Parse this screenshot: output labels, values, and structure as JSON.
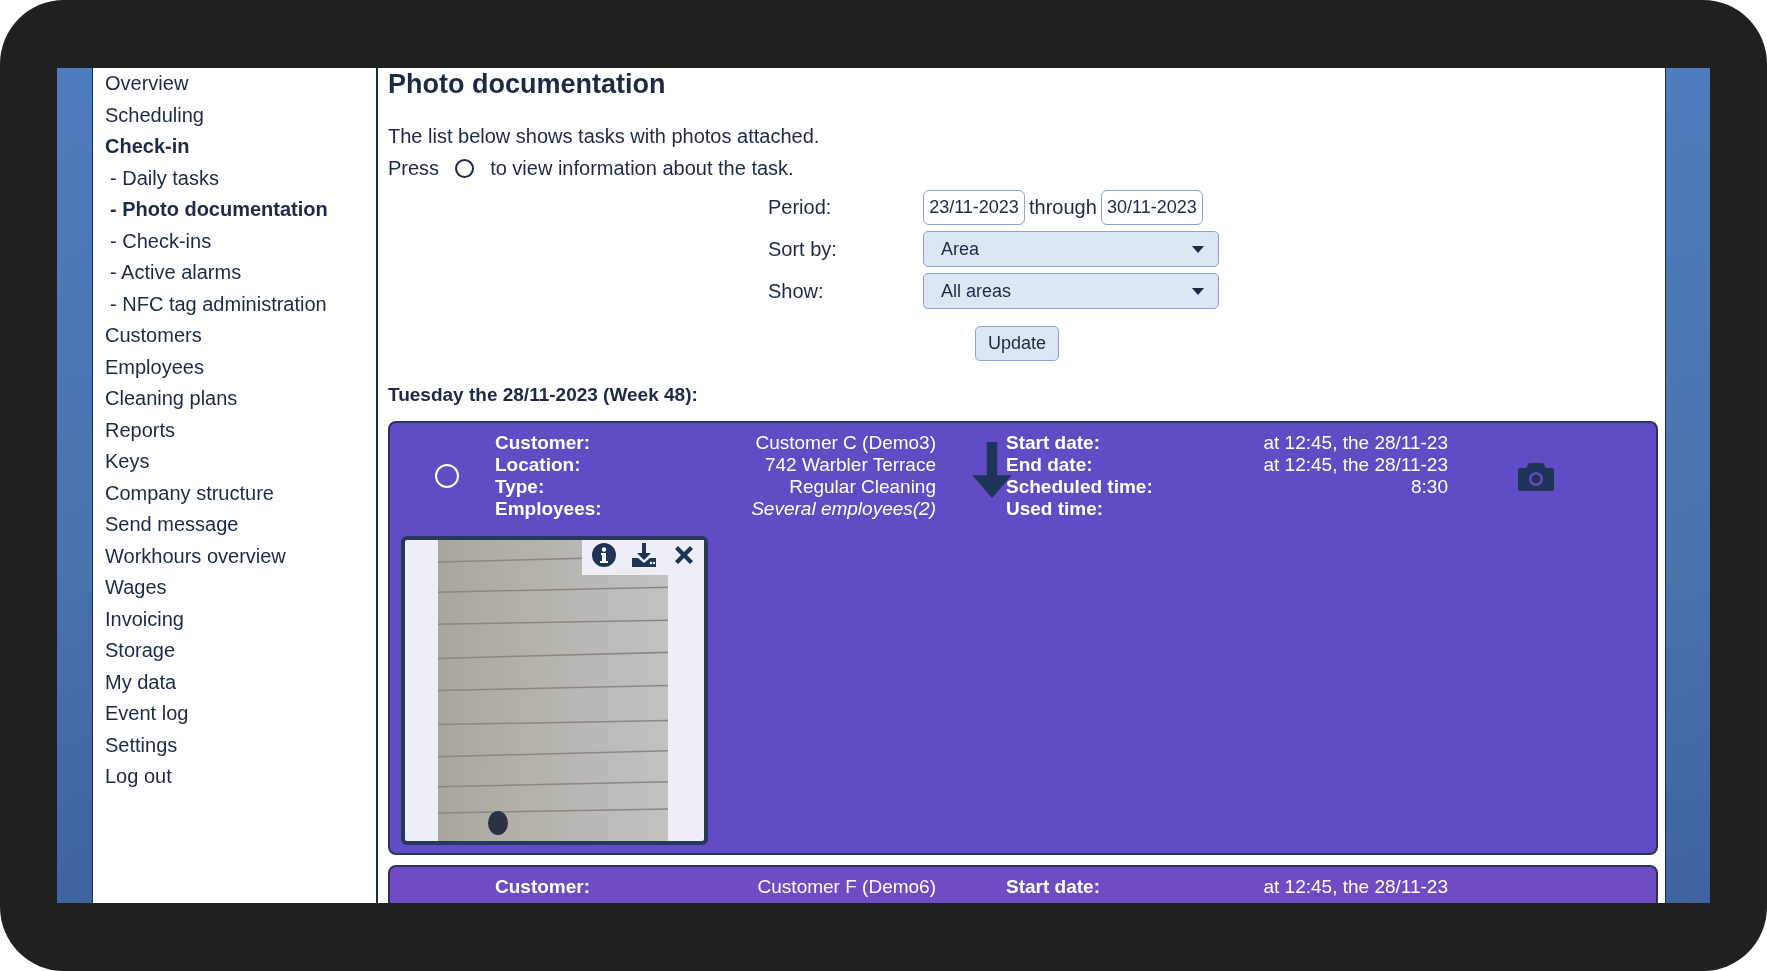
{
  "sidebar": {
    "items": [
      {
        "label": "Overview",
        "selected": false
      },
      {
        "label": "Scheduling",
        "selected": false
      },
      {
        "label": "Check-in",
        "selected": true,
        "children": [
          {
            "label": "- Daily tasks",
            "selected": false
          },
          {
            "label": "- Photo documentation",
            "selected": true
          },
          {
            "label": "- Check-ins",
            "selected": false
          },
          {
            "label": "- Active alarms",
            "selected": false
          },
          {
            "label": "- NFC tag administration",
            "selected": false
          }
        ]
      },
      {
        "label": "Customers",
        "selected": false
      },
      {
        "label": "Employees",
        "selected": false
      },
      {
        "label": "Cleaning plans",
        "selected": false
      },
      {
        "label": "Reports",
        "selected": false
      },
      {
        "label": "Keys",
        "selected": false
      },
      {
        "label": "Company structure",
        "selected": false
      },
      {
        "label": "Send message",
        "selected": false
      },
      {
        "label": "Workhours overview",
        "selected": false
      },
      {
        "label": "Wages",
        "selected": false
      },
      {
        "label": "Invoicing",
        "selected": false
      },
      {
        "label": "Storage",
        "selected": false
      },
      {
        "label": "My data",
        "selected": false
      },
      {
        "label": "Event log",
        "selected": false
      },
      {
        "label": "Settings",
        "selected": false
      },
      {
        "label": "Log out",
        "selected": false
      }
    ]
  },
  "page": {
    "title": "Photo documentation",
    "intro": "The list below shows tasks with photos attached.",
    "hint_before": "Press",
    "hint_after": "to view information about the task."
  },
  "filters": {
    "period_label": "Period:",
    "period_from": "23/11-2023",
    "period_joiner": "through",
    "period_to": "30/11-2023",
    "sort_label": "Sort by:",
    "sort_value": "Area",
    "show_label": "Show:",
    "show_value": "All areas",
    "update_button": "Update"
  },
  "day_heading": "Tuesday the 28/11-2023 (Week 48):",
  "tasks": [
    {
      "color": "#604cc4",
      "selected": false,
      "fields": [
        {
          "label": "Customer:",
          "value": "Customer C (Demo3)",
          "italic": false
        },
        {
          "label": "Start date:",
          "value": "at 12:45, the 28/11-23",
          "italic": false
        },
        {
          "label": "Location:",
          "value": "742 Warbler Terrace",
          "italic": false
        },
        {
          "label": "End date:",
          "value": "at 12:45, the 28/11-23",
          "italic": false
        },
        {
          "label": "Type:",
          "value": "Regular Cleaning",
          "italic": false
        },
        {
          "label": "Scheduled time:",
          "value": "8:30",
          "italic": false
        },
        {
          "label": "Employees:",
          "value": "Several employees(2)",
          "italic": true
        },
        {
          "label": "Used time:"
        }
      ]
    },
    {
      "color": "#6e4cc3",
      "fields": [
        {
          "label": "Customer:",
          "value": "Customer F (Demo6)",
          "italic": false
        },
        {
          "label": "Start date:",
          "value": "at 12:45, the 28/11-23",
          "italic": false
        }
      ]
    }
  ]
}
